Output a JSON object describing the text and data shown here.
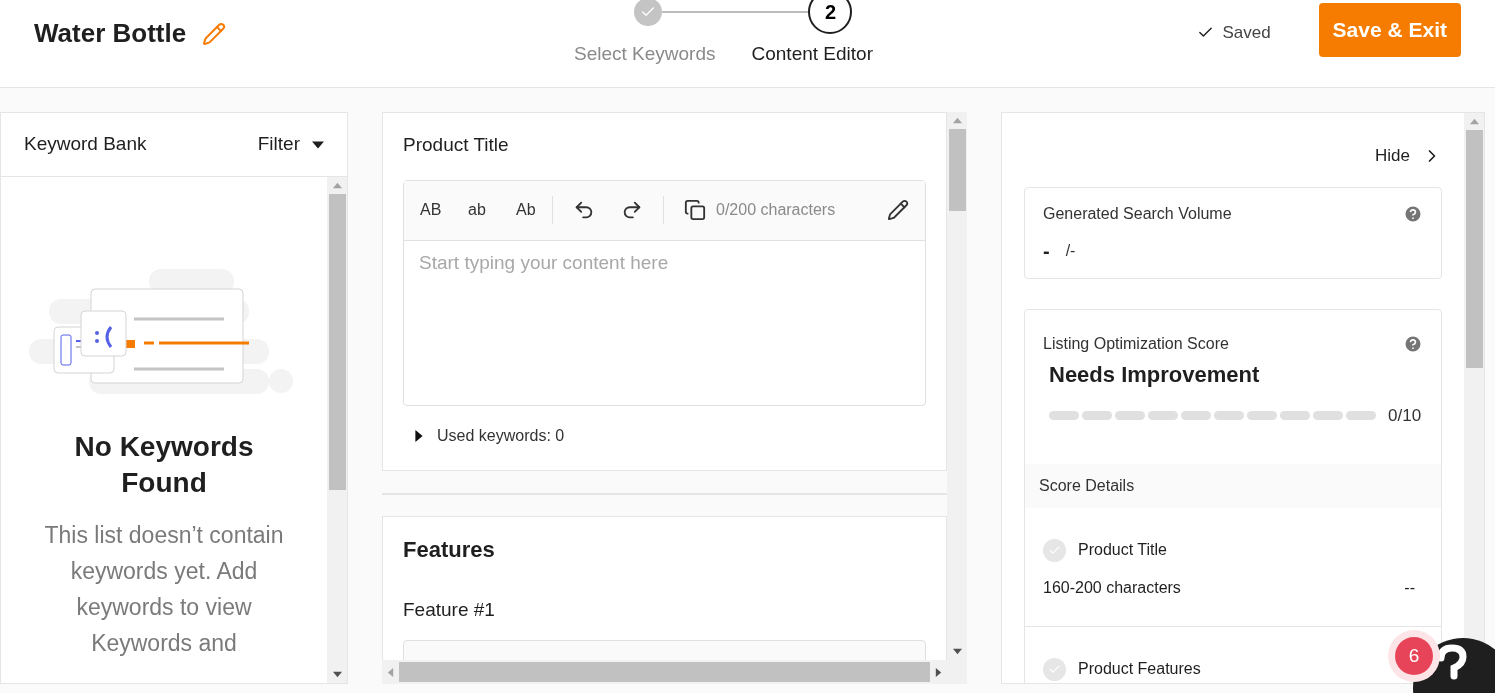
{
  "header": {
    "title": "Water Bottle",
    "steps": [
      {
        "label": "Select Keywords",
        "done": true,
        "selected": false
      },
      {
        "label": "Content Editor",
        "number": "2",
        "done": false,
        "selected": true
      }
    ],
    "saved": "Saved",
    "save_button": "Save & Exit"
  },
  "keyword_bank": {
    "title": "Keyword Bank",
    "filter": "Filter",
    "empty_title": "No Keywords Found",
    "empty_text": "This list doesn’t contain keywords yet. Add keywords to view Keywords and"
  },
  "editor": {
    "sections": [
      {
        "kind": "field",
        "title": "Product Title",
        "toolbar": [
          "AB",
          "ab",
          "Ab"
        ],
        "counter": "0/200 characters",
        "placeholder": "Start typing your content here",
        "used_keywords": "Used keywords: 0",
        "expanded": false
      },
      {
        "kind": "group",
        "title": "Features",
        "subtitle": "Feature #1"
      }
    ]
  },
  "score_panel": {
    "hide": "Hide",
    "search_volume": {
      "title": "Generated Search Volume",
      "value": "-",
      "total": "/-"
    },
    "score": {
      "title": "Listing Optimization Score",
      "rating": "Needs Improvement",
      "stars": 0,
      "reading": "0/10"
    },
    "details_title": "Score Details",
    "details": [
      {
        "title": "Product Title",
        "note": "160-200 characters",
        "value": "--",
        "done": false
      },
      {
        "title": "Product Features",
        "done": false
      }
    ]
  },
  "help": {
    "badge": "6"
  }
}
